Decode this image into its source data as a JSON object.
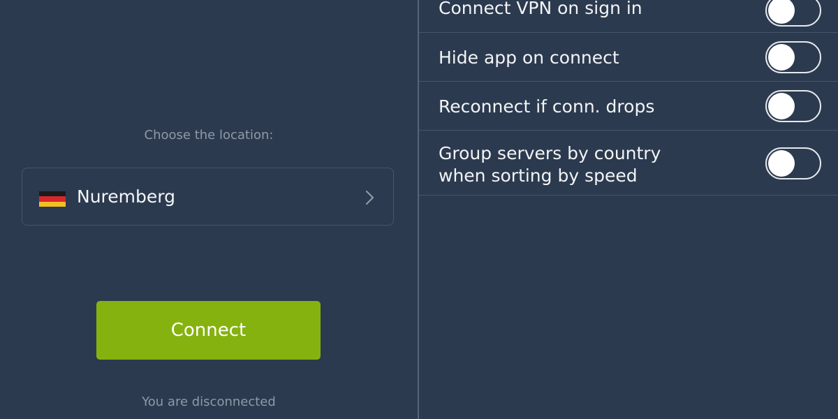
{
  "location": {
    "prompt": "Choose the location:",
    "selected_city": "Nuremberg",
    "flag_country": "Germany",
    "flag_colors": [
      "#1b1b1b",
      "#d8262d",
      "#f4c020"
    ]
  },
  "connect_button_label": "Connect",
  "status": "You are disconnected",
  "settings": [
    {
      "label": "Connect VPN on sign in",
      "enabled": false
    },
    {
      "label": "Hide app on connect",
      "enabled": false
    },
    {
      "label": "Reconnect if conn. drops",
      "enabled": false
    },
    {
      "label": "Group servers by country\nwhen sorting by speed",
      "enabled": false
    }
  ],
  "colors": {
    "background": "#2c3a4f",
    "accent_green": "#86b20f",
    "muted_text": "#8f9aa8",
    "divider": "#46556a"
  },
  "icons": {
    "location_chevron": "chevron-right-icon",
    "flag": "germany-flag-icon"
  }
}
